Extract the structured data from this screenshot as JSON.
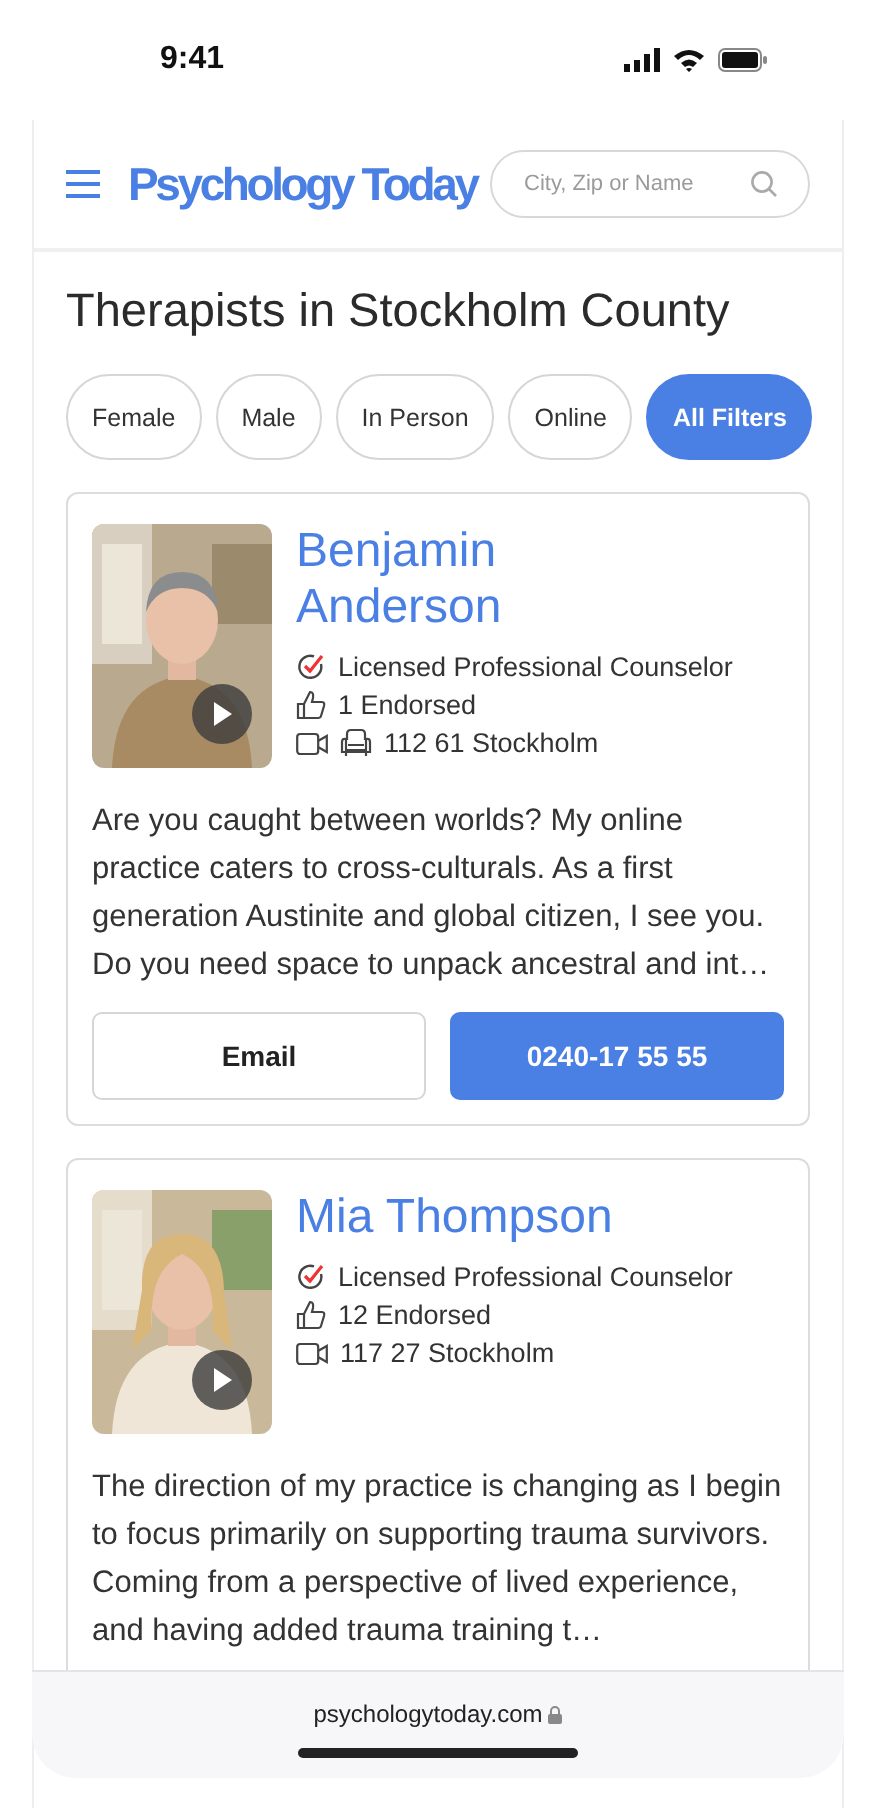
{
  "status_bar": {
    "time": "9:41"
  },
  "header": {
    "logo": "Psychology Today",
    "search": {
      "placeholder": "City, Zip or Name"
    }
  },
  "title": "Therapists in Stockholm County",
  "filters": [
    {
      "label": "Female",
      "kind": "chip"
    },
    {
      "label": "Male",
      "kind": "chip"
    },
    {
      "label": "In Person",
      "kind": "chip"
    },
    {
      "label": "Online",
      "kind": "chip"
    },
    {
      "label": "All Filters",
      "kind": "primary"
    }
  ],
  "therapists": [
    {
      "name": "Benjamin Anderson",
      "credential": "Licensed Professional Counselor",
      "endorsed": "1 Endorsed",
      "online": true,
      "in_person": true,
      "location": "112 61 Stockholm",
      "bio": "Are you caught between worlds? My online practice caters to cross-culturals. As a first generation Austinite and global citizen, I see you. Do you need space to unpack ancestral and int…",
      "email": "Email",
      "phone": "0240-17 55 55"
    },
    {
      "name": "Mia Thompson",
      "credential": "Licensed Professional Counselor",
      "endorsed": "12 Endorsed",
      "online": true,
      "in_person": false,
      "location": "117 27 Stockholm",
      "bio": "The direction of my practice is changing as I begin to focus primarily on supporting trauma survivors. Coming from a perspective of lived experience, and having added trauma training t…"
    }
  ],
  "browser_bar": {
    "url": "psychologytoday.com"
  }
}
